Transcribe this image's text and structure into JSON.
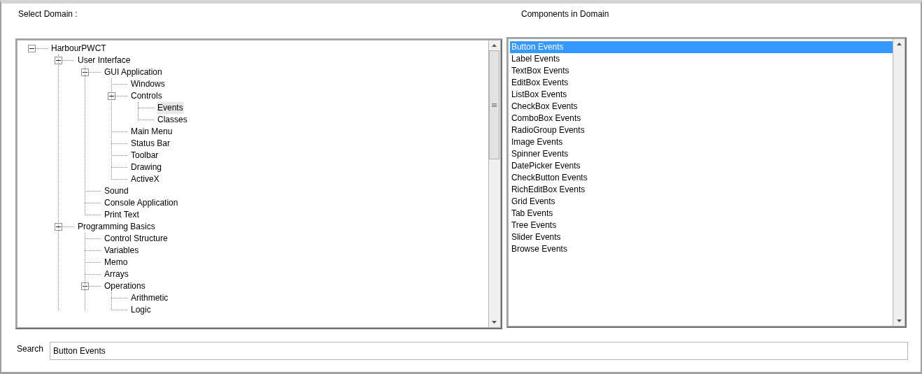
{
  "domain_label": "Select Domain :",
  "components_label": "Components in Domain",
  "tree": [
    {
      "label": "HarbourPWCT",
      "expanded": true,
      "selected": false,
      "children": [
        {
          "label": "User Interface",
          "expanded": true,
          "selected": false,
          "children": [
            {
              "label": "GUI Application",
              "expanded": true,
              "selected": false,
              "children": [
                {
                  "label": "Windows",
                  "selected": false
                },
                {
                  "label": "Controls",
                  "expanded": true,
                  "selected": false,
                  "children": [
                    {
                      "label": "Events",
                      "selected": true
                    },
                    {
                      "label": "Classes",
                      "selected": false
                    }
                  ]
                },
                {
                  "label": "Main Menu",
                  "selected": false
                },
                {
                  "label": "Status Bar",
                  "selected": false
                },
                {
                  "label": "Toolbar",
                  "selected": false
                },
                {
                  "label": "Drawing",
                  "selected": false
                },
                {
                  "label": "ActiveX",
                  "selected": false
                }
              ]
            },
            {
              "label": "Sound",
              "selected": false
            },
            {
              "label": "Console Application",
              "selected": false
            },
            {
              "label": "Print Text",
              "selected": false
            }
          ]
        },
        {
          "label": "Programming Basics",
          "expanded": true,
          "selected": false,
          "children": [
            {
              "label": "Control Structure",
              "selected": false
            },
            {
              "label": "Variables",
              "selected": false
            },
            {
              "label": "Memo",
              "selected": false
            },
            {
              "label": "Arrays",
              "selected": false
            },
            {
              "label": "Operations",
              "expanded": true,
              "selected": false,
              "children": [
                {
                  "label": "Arithmetic",
                  "selected": false
                },
                {
                  "label": "Logic",
                  "selected": false
                }
              ]
            }
          ]
        }
      ]
    }
  ],
  "components": [
    {
      "label": "Button Events",
      "selected": true
    },
    {
      "label": "Label Events",
      "selected": false
    },
    {
      "label": "TextBox Events",
      "selected": false
    },
    {
      "label": "EditBox Events",
      "selected": false
    },
    {
      "label": "ListBox Events",
      "selected": false
    },
    {
      "label": "CheckBox Events",
      "selected": false
    },
    {
      "label": "ComboBox Events",
      "selected": false
    },
    {
      "label": "RadioGroup Events",
      "selected": false
    },
    {
      "label": "Image Events",
      "selected": false
    },
    {
      "label": "Spinner Events",
      "selected": false
    },
    {
      "label": "DatePicker Events",
      "selected": false
    },
    {
      "label": "CheckButton Events",
      "selected": false
    },
    {
      "label": "RichEditBox Events",
      "selected": false
    },
    {
      "label": "Grid Events",
      "selected": false
    },
    {
      "label": "Tab Events",
      "selected": false
    },
    {
      "label": "Tree Events",
      "selected": false
    },
    {
      "label": "Slider Events",
      "selected": false
    },
    {
      "label": "Browse Events",
      "selected": false
    }
  ],
  "search": {
    "label": "Search",
    "value": "Button Events"
  }
}
